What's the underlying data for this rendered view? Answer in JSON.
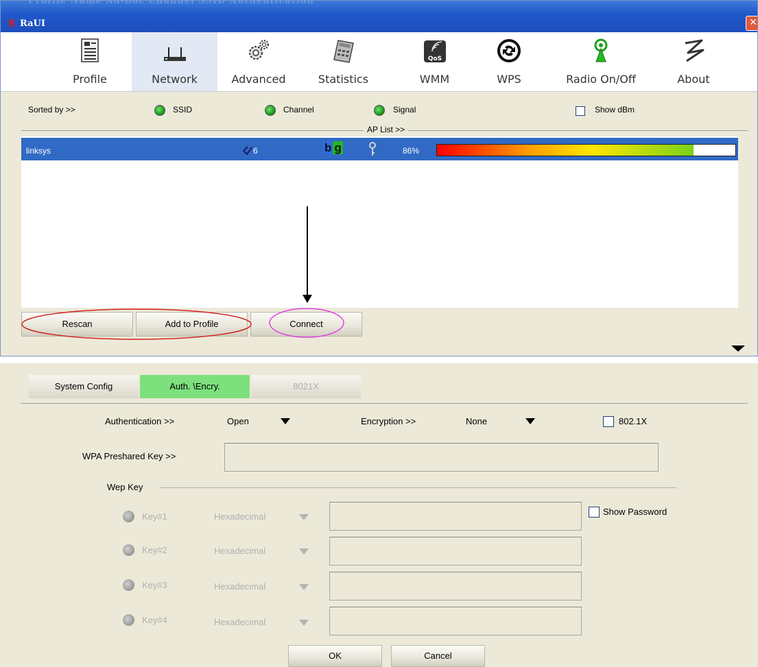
{
  "window": {
    "title": "RaUI",
    "ghost_title": "Profile Name  Ad-hoc Channel  SSID  Authentication",
    "close_glyph": "✕"
  },
  "toolbar": {
    "items": [
      {
        "label": "Profile",
        "icon": "profile-icon"
      },
      {
        "label": "Network",
        "icon": "network-icon",
        "selected": true
      },
      {
        "label": "Advanced",
        "icon": "gears-icon"
      },
      {
        "label": "Statistics",
        "icon": "calculator-icon"
      },
      {
        "label": "WMM",
        "icon": "qos-icon"
      },
      {
        "label": "WPS",
        "icon": "wps-icon"
      },
      {
        "label": "Radio On/Off",
        "icon": "radio-antenna-icon"
      },
      {
        "label": "About",
        "icon": "about-icon"
      }
    ]
  },
  "sort": {
    "label": "Sorted by >>",
    "ssid": "SSID",
    "channel": "Channel",
    "signal": "Signal",
    "show_dbm": "Show dBm",
    "ap_list": "AP List >>"
  },
  "ap_list": {
    "rows": [
      {
        "ssid": "linksys",
        "channel": "6",
        "signal": "86%",
        "signal_level": 0.86
      }
    ]
  },
  "buttons": {
    "rescan": "Rescan",
    "add_to_profile": "Add to Profile",
    "connect": "Connect"
  },
  "config_tabs": {
    "system_config": "System Config",
    "auth_encry": "Auth. \\Encry.",
    "ieee8021x": "8021X"
  },
  "auth": {
    "authentication_label": "Authentication >>",
    "authentication_value": "Open",
    "encryption_label": "Encryption >>",
    "encryption_value": "None",
    "ieee8021x_label": "802.1X",
    "wpa_label": "WPA Preshared Key >>",
    "wpa_value": "",
    "wep_key_label": "Wep Key",
    "show_password": "Show Password",
    "keys": [
      {
        "label": "Key#1",
        "format": "Hexadecimal",
        "value": ""
      },
      {
        "label": "Key#2",
        "format": "Hexadecimal",
        "value": ""
      },
      {
        "label": "Key#3",
        "format": "Hexadecimal",
        "value": ""
      },
      {
        "label": "Key#4",
        "format": "Hexadecimal",
        "value": ""
      }
    ],
    "ok": "OK",
    "cancel": "Cancel"
  }
}
